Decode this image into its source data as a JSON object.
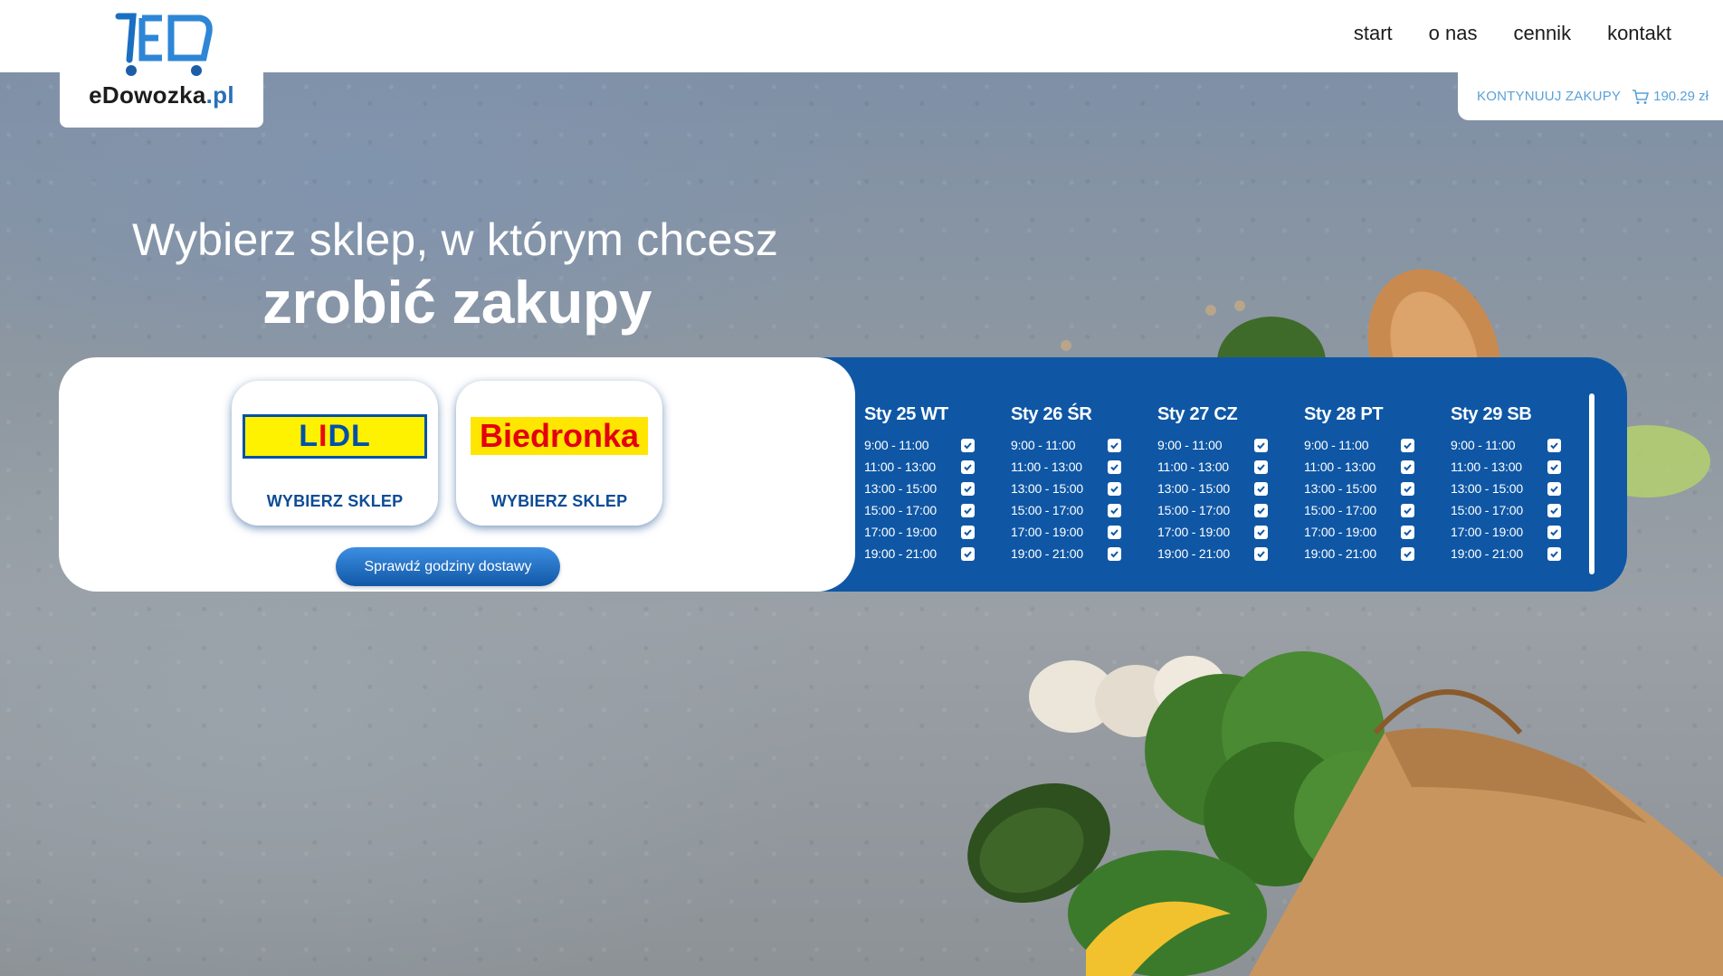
{
  "logo": {
    "name": "eDowozka",
    "domain": ".pl"
  },
  "nav": {
    "items": [
      "start",
      "o nas",
      "cennik",
      "kontakt"
    ]
  },
  "cart": {
    "continue_label": "KONTYNUUJ ZAKUPY",
    "total": "190.29 zł"
  },
  "headline": {
    "line1": "Wybierz sklep, w którym chcesz",
    "line2": "zrobić zakupy"
  },
  "stores": [
    {
      "name": "LIDL",
      "button_label": "WYBIERZ SKLEP"
    },
    {
      "name": "Biedronka",
      "button_label": "WYBIERZ SKLEP"
    }
  ],
  "check_hours_label": "Sprawdź godziny dostawy",
  "days": [
    {
      "label": "Sty 25 WT",
      "slots": [
        "9:00 - 11:00",
        "11:00 - 13:00",
        "13:00 - 15:00",
        "15:00 - 17:00",
        "17:00 - 19:00",
        "19:00 - 21:00"
      ]
    },
    {
      "label": "Sty 26 ŚR",
      "slots": [
        "9:00 - 11:00",
        "11:00 - 13:00",
        "13:00 - 15:00",
        "15:00 - 17:00",
        "17:00 - 19:00",
        "19:00 - 21:00"
      ]
    },
    {
      "label": "Sty 27 CZ",
      "slots": [
        "9:00 - 11:00",
        "11:00 - 13:00",
        "13:00 - 15:00",
        "15:00 - 17:00",
        "17:00 - 19:00",
        "19:00 - 21:00"
      ]
    },
    {
      "label": "Sty 28 PT",
      "slots": [
        "9:00 - 11:00",
        "11:00 - 13:00",
        "13:00 - 15:00",
        "15:00 - 17:00",
        "17:00 - 19:00",
        "19:00 - 21:00"
      ]
    },
    {
      "label": "Sty 29 SB",
      "slots": [
        "9:00 - 11:00",
        "11:00 - 13:00",
        "13:00 - 15:00",
        "15:00 - 17:00",
        "17:00 - 19:00",
        "19:00 - 21:00"
      ]
    }
  ],
  "colors": {
    "accent": "#0f57a5",
    "link": "#5aa2d9",
    "lidl_yellow": "#fff200",
    "biedronka_red": "#e3000f"
  }
}
